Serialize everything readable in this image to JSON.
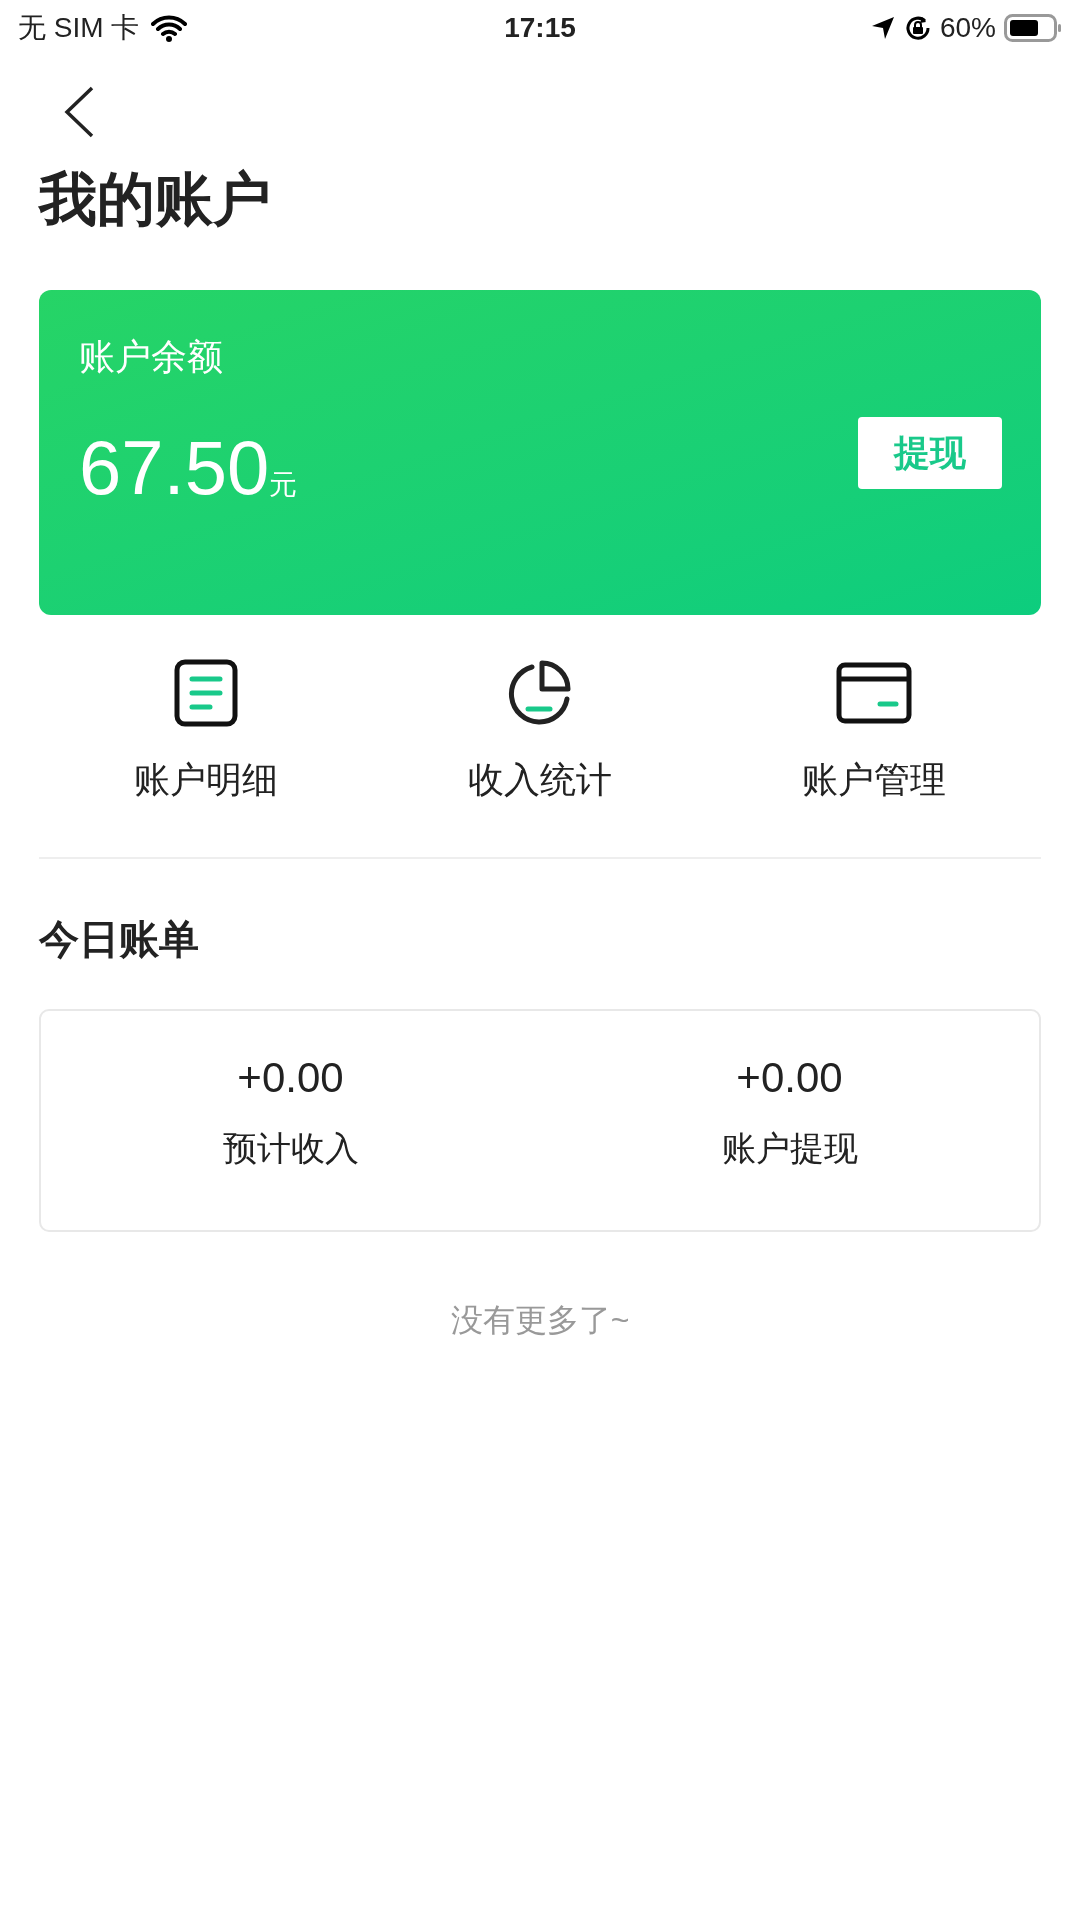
{
  "status_bar": {
    "carrier": "无 SIM 卡",
    "time": "17:15",
    "battery": "60%"
  },
  "title": "我的账户",
  "balance_card": {
    "label": "账户余额",
    "amount": "67.50",
    "unit": "元",
    "button": "提现"
  },
  "shortcuts": [
    {
      "kind": "list",
      "label": "账户明细"
    },
    {
      "kind": "pie",
      "label": "收入统计"
    },
    {
      "kind": "card",
      "label": "账户管理"
    }
  ],
  "today": {
    "heading": "今日账单",
    "stats": [
      {
        "value": "+0.00",
        "label": "预计收入"
      },
      {
        "value": "+0.00",
        "label": "账户提现"
      }
    ]
  },
  "footer": "没有更多了~"
}
